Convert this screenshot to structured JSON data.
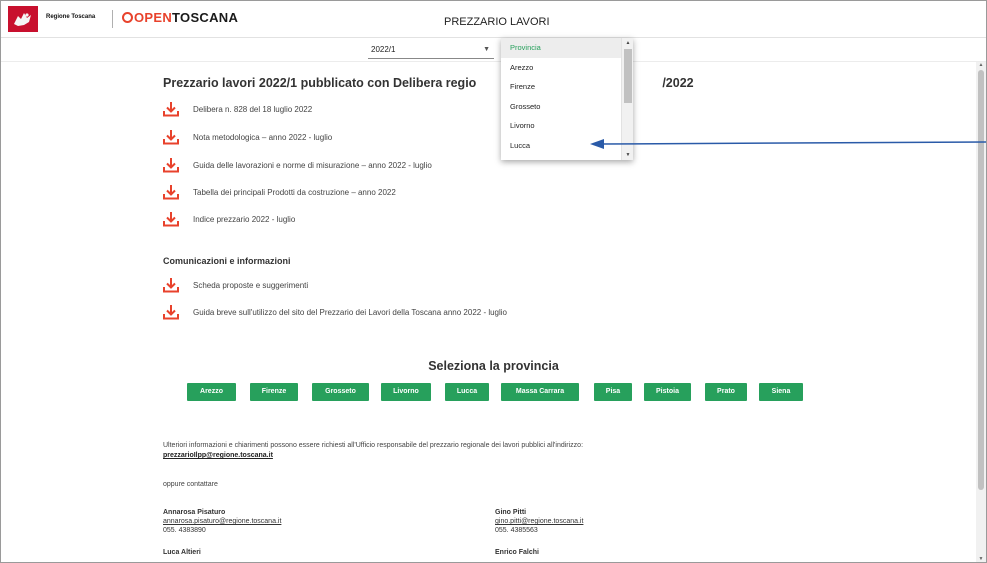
{
  "header": {
    "regione_label": "Regione Toscana",
    "brand_open": "OPEN",
    "brand_toscana": "TOSCANA",
    "title": "PREZZARIO LAVORI"
  },
  "year_select": {
    "value": "2022/1"
  },
  "dropdown": {
    "options": [
      "Provincia",
      "Arezzo",
      "Firenze",
      "Grosseto",
      "Livorno",
      "Lucca"
    ],
    "selected": "Provincia"
  },
  "main": {
    "title": "Prezzario lavori 2022/1 pubblicato con Delibera regio",
    "title_tail": "/2022",
    "documents": [
      "Delibera n. 828 del 18 luglio 2022",
      "Nota metodologica – anno 2022 - luglio",
      "Guida delle lavorazioni e norme di misurazione – anno 2022 - luglio",
      "Tabella dei principali Prodotti da costruzione – anno 2022",
      "Indice prezzario 2022 - luglio"
    ],
    "communications_heading": "Comunicazioni e informazioni",
    "communications": [
      "Scheda proposte e suggerimenti",
      "Guida breve sull'utilizzo del sito del Prezzario dei Lavori della Toscana anno 2022 - luglio"
    ],
    "province_heading": "Seleziona la provincia",
    "provinces": [
      "Arezzo",
      "Firenze",
      "Grosseto",
      "Livorno",
      "Lucca",
      "Massa Carrara",
      "Pisa",
      "Pistoia",
      "Prato",
      "Siena"
    ],
    "info_text": "Ulteriori informazioni e chiarimenti possono essere richiesti all'Ufficio responsabile del prezzario regionale dei lavori pubblici all'indirizzo:",
    "info_email": "prezzarioIlpp@regione.toscana.it",
    "oppure": "oppure contattare",
    "contacts": [
      {
        "name": "Annarosa Pisaturo",
        "email": "annarosa.pisaturo@regione.toscana.it",
        "phone": "055. 4383890"
      },
      {
        "name": "Gino Pitti",
        "email": "gino.pitti@regione.toscana.it",
        "phone": "055. 4385563"
      },
      {
        "name": "Luca Altieri",
        "email": "",
        "phone": ""
      },
      {
        "name": "Enrico Falchi",
        "email": "",
        "phone": ""
      }
    ]
  },
  "colors": {
    "accent_green": "#27a05c",
    "accent_orange": "#e8422c",
    "brand_red": "#c8102e",
    "annotation_blue": "#2a5aa8"
  },
  "icons": {
    "download": "download-icon",
    "logo": "pegasus-logo-icon"
  }
}
